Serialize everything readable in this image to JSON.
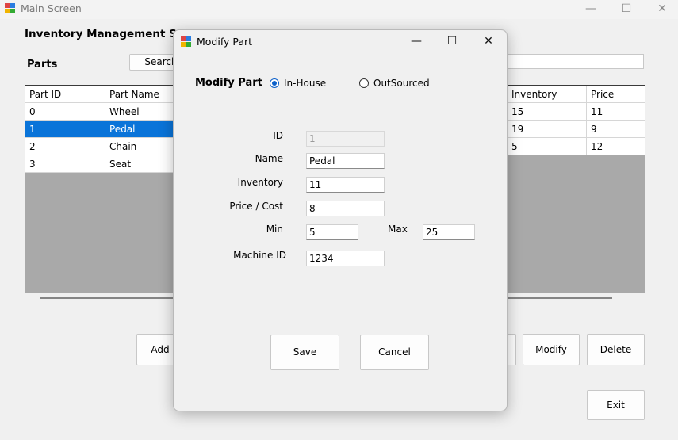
{
  "window": {
    "title": "Main Screen",
    "minimize_glyph": "—",
    "maximize_glyph": "☐",
    "close_glyph": "✕"
  },
  "main": {
    "heading": "Inventory Management System",
    "parts_label": "Parts",
    "search_label": "Search",
    "search_value": "",
    "add_label": "Add",
    "modify_label": "Modify",
    "delete_label": "Delete",
    "exit_label": "Exit"
  },
  "grid": {
    "headers": [
      "Part ID",
      "Part Name",
      "Inventory",
      "Price"
    ],
    "rows": [
      {
        "id": "0",
        "name": "Wheel",
        "inventory": "15",
        "price": "11"
      },
      {
        "id": "1",
        "name": "Pedal",
        "inventory": "19",
        "price": "9"
      },
      {
        "id": "2",
        "name": "Chain",
        "inventory": "5",
        "price": "12"
      },
      {
        "id": "3",
        "name": "Seat",
        "inventory": "",
        "price": ""
      }
    ],
    "selected_row": 1,
    "colors": {
      "selection": "#0a74d9",
      "empty_area": "#a9a9a9"
    }
  },
  "dialog": {
    "title": "Modify Part",
    "heading": "Modify Part",
    "radio_inhouse": "In-House",
    "radio_outsourced": "OutSourced",
    "source_selected": "In-House",
    "labels": {
      "id": "ID",
      "name": "Name",
      "inventory": "Inventory",
      "price": "Price / Cost",
      "min": "Min",
      "max": "Max",
      "machine_id": "Machine ID"
    },
    "values": {
      "id": "1",
      "name": "Pedal",
      "inventory": "11",
      "price": "8",
      "min": "5",
      "max": "25",
      "machine_id": "1234"
    },
    "save_label": "Save",
    "cancel_label": "Cancel"
  },
  "icons": {
    "app": "app-icon",
    "radio_on": "radio-selected-icon",
    "radio_off": "radio-unselected-icon"
  }
}
